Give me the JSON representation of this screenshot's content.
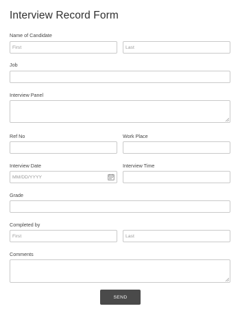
{
  "form": {
    "title": "Interview Record Form",
    "name_of_candidate": {
      "label": "Name of Candidate",
      "first_placeholder": "First",
      "last_placeholder": "Last"
    },
    "job": {
      "label": "Job",
      "value": ""
    },
    "interview_panel": {
      "label": "Interview Panel",
      "value": ""
    },
    "ref_no": {
      "label": "Ref No",
      "value": ""
    },
    "work_place": {
      "label": "Work Place",
      "value": ""
    },
    "interview_date": {
      "label": "Interview Date",
      "placeholder": "MM/DD/YYYY",
      "icon": "calendar-icon"
    },
    "interview_time": {
      "label": "Interview Time",
      "value": ""
    },
    "grade": {
      "label": "Grade",
      "value": ""
    },
    "completed_by": {
      "label": "Completed by",
      "first_placeholder": "First",
      "last_placeholder": "Last"
    },
    "comments": {
      "label": "Comments",
      "value": ""
    },
    "send_label": "SEND"
  }
}
